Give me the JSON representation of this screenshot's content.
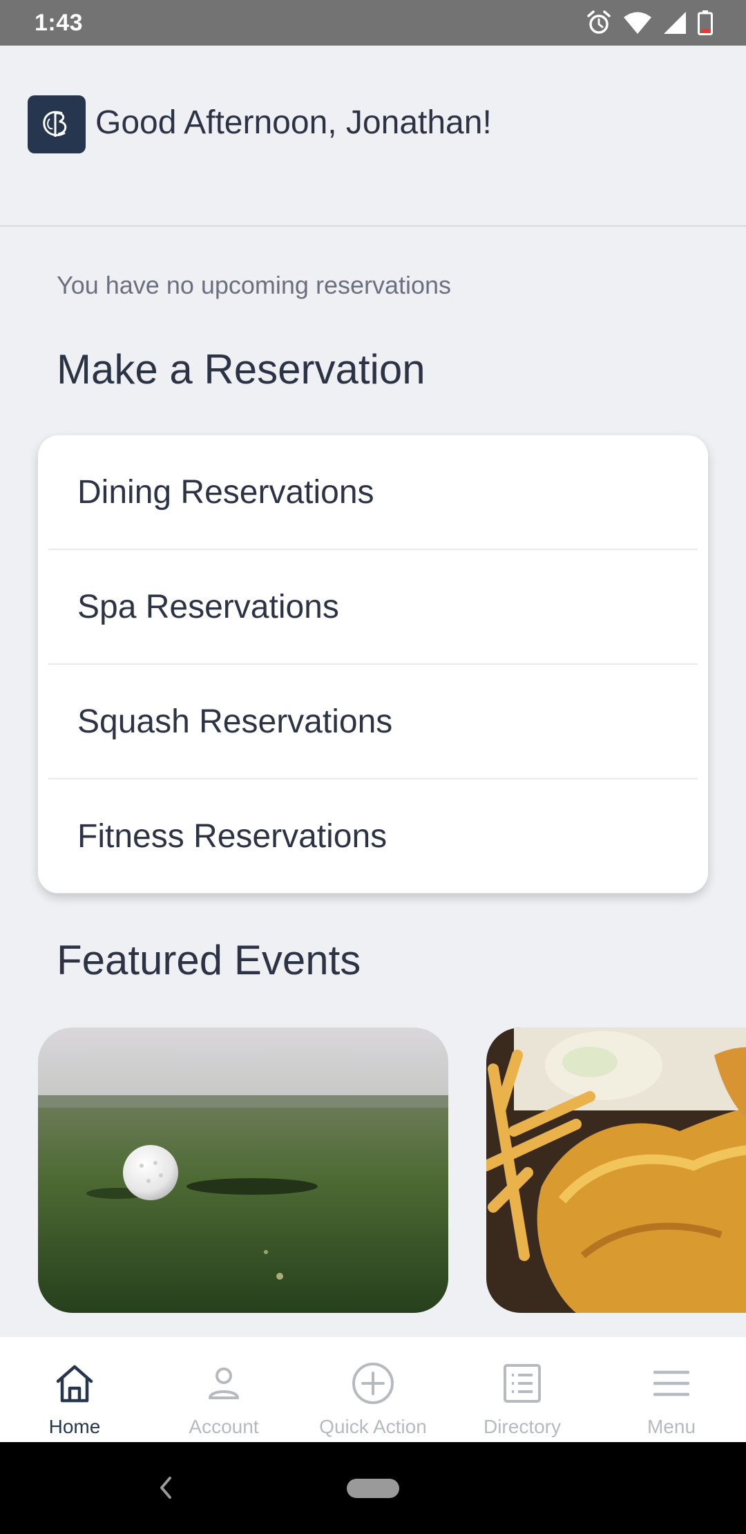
{
  "status_bar": {
    "time": "1:43",
    "icons": [
      "alarm-icon",
      "wifi-icon",
      "signal-icon",
      "battery-icon"
    ]
  },
  "header": {
    "logo_icon": "club-monogram-logo",
    "greeting": "Good Afternoon, Jonathan!"
  },
  "reservations": {
    "empty_message": "You have no upcoming reservations",
    "section_title": "Make a Reservation",
    "items": [
      {
        "label": "Dining Reservations"
      },
      {
        "label": "Spa Reservations"
      },
      {
        "label": "Squash Reservations"
      },
      {
        "label": "Fitness Reservations"
      }
    ]
  },
  "featured": {
    "section_title": "Featured Events",
    "events": [
      {
        "image": "golf-ball-on-green"
      },
      {
        "image": "fish-and-chips"
      }
    ]
  },
  "bottom_nav": {
    "active": "Home",
    "items": [
      {
        "label": "Home",
        "icon": "home-icon"
      },
      {
        "label": "Account",
        "icon": "person-icon"
      },
      {
        "label": "Quick Action",
        "icon": "plus-circle-icon"
      },
      {
        "label": "Directory",
        "icon": "list-icon"
      },
      {
        "label": "Menu",
        "icon": "hamburger-menu-icon"
      }
    ]
  },
  "colors": {
    "background": "#eef0f4",
    "primary_text": "#2c3345",
    "logo_bg": "#27364f",
    "nav_inactive": "#b6b9c0",
    "status_bar": "#737373"
  }
}
